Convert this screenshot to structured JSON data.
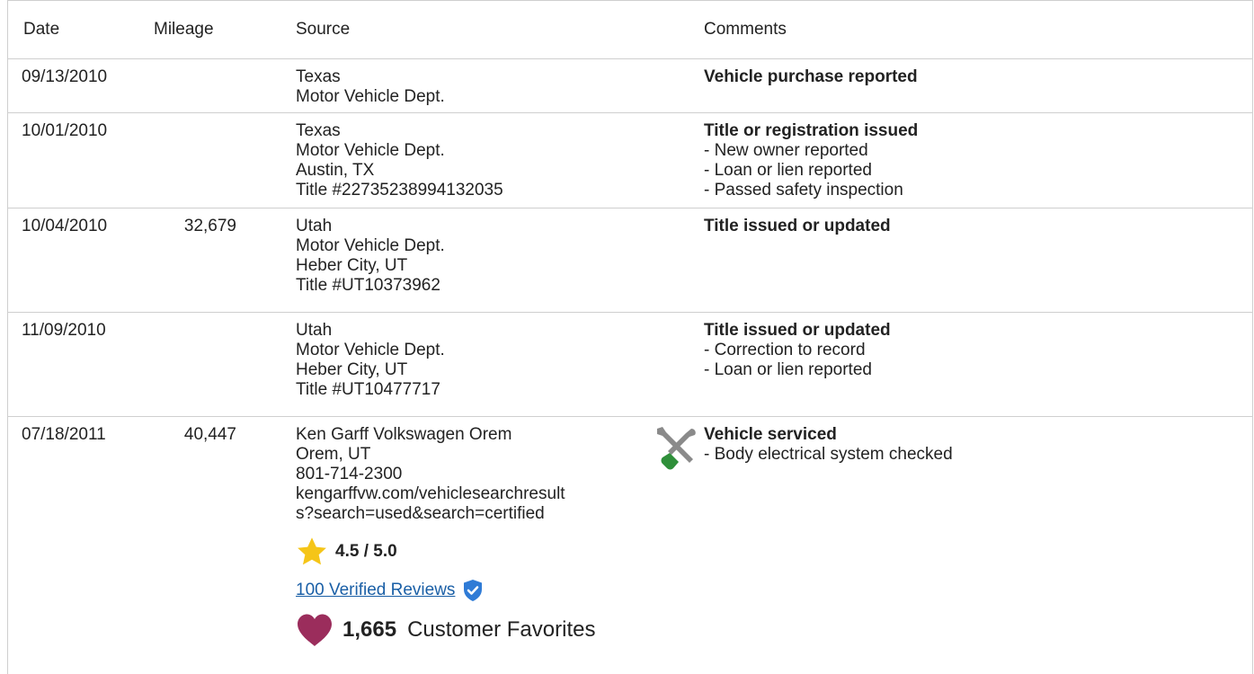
{
  "columns": {
    "date": "Date",
    "mileage": "Mileage",
    "source": "Source",
    "comments": "Comments"
  },
  "rows": [
    {
      "date": "09/13/2010",
      "mileage": "",
      "source": [
        "Texas",
        "Motor Vehicle Dept."
      ],
      "comment_title": "Vehicle purchase reported",
      "comment_items": []
    },
    {
      "date": "10/01/2010",
      "mileage": "",
      "source": [
        "Texas",
        "Motor Vehicle Dept.",
        "Austin, TX",
        "Title #22735238994132035"
      ],
      "comment_title": "Title or registration issued",
      "comment_items": [
        "- New owner reported",
        "- Loan or lien reported",
        "- Passed safety inspection"
      ]
    },
    {
      "date": "10/04/2010",
      "mileage": "32,679",
      "source": [
        "Utah",
        "Motor Vehicle Dept.",
        "Heber City, UT",
        "Title #UT10373962"
      ],
      "comment_title": "Title issued or updated",
      "comment_items": []
    },
    {
      "date": "11/09/2010",
      "mileage": "",
      "source": [
        "Utah",
        "Motor Vehicle Dept.",
        "Heber City, UT",
        "Title #UT10477717"
      ],
      "comment_title": "Title issued or updated",
      "comment_items": [
        "- Correction to record",
        "- Loan or lien reported"
      ]
    },
    {
      "date": "07/18/2011",
      "mileage": "40,447",
      "source": [
        "Ken Garff Volkswagen Orem",
        "Orem, UT",
        "801-714-2300"
      ],
      "source_url": "kengarffvw.com/vehiclesearchresults?search=used&search=certified",
      "rating": "4.5 / 5.0",
      "reviews_link": "100 Verified Reviews",
      "favorites_count": "1,665",
      "favorites_label": "Customer Favorites",
      "icon": "service-tools-icon",
      "comment_title": "Vehicle serviced",
      "comment_items": [
        "- Body electrical system checked"
      ]
    }
  ],
  "colors": {
    "border": "#cfcfcf",
    "link": "#1a5fa6",
    "star": "#f5c518",
    "heart": "#9b2d5c",
    "shield": "#2f7bd6",
    "wrench": "#8a8a8a",
    "screwdriver_handle": "#2f8f3a"
  }
}
